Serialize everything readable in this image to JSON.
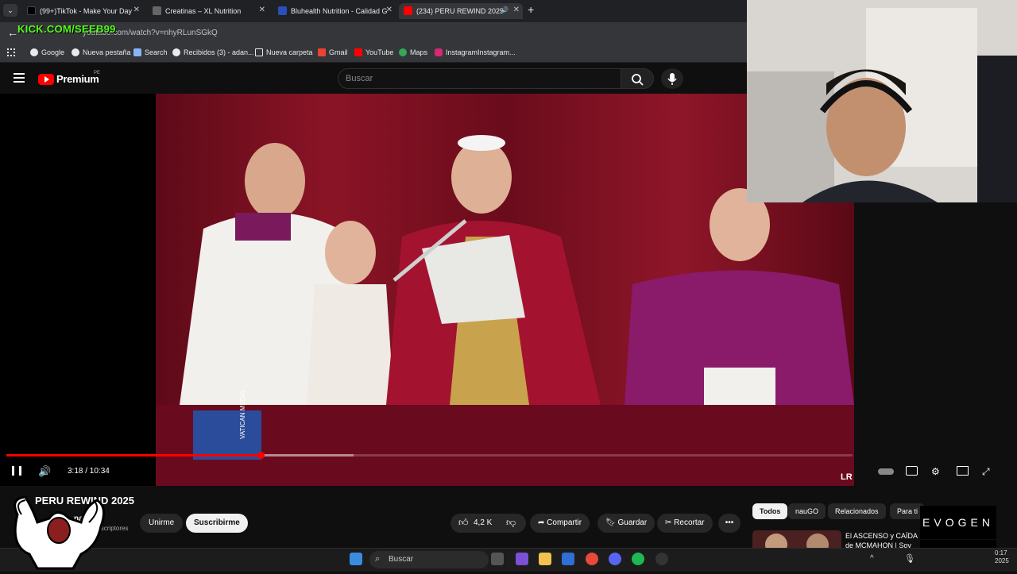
{
  "browser": {
    "tabs": [
      {
        "title": "(99+)TikTok - Make Your Day",
        "active": false
      },
      {
        "title": "Creatinas – XL Nutrition",
        "active": false
      },
      {
        "title": "Bluhealth Nutrition - Calidad G",
        "active": false
      },
      {
        "title": "(234) PERU REWIND 2025",
        "active": true
      }
    ],
    "tab_close": "✕",
    "new_tab": "+",
    "url": "youtube.com/watch?v=nhyRLunSGkQ",
    "bookmarks": [
      "Google",
      "Nueva pestaña",
      "Search",
      "Recibidos (3) - adan...",
      "Nueva carpeta",
      "Gmail",
      "YouTube",
      "Maps",
      "InstagramInstagram..."
    ]
  },
  "stream_overlay": {
    "kick_handle": "KICK.COM/SEEB99",
    "evogen_top": "EVOGEN",
    "evogen_bottom": "EVOGEN"
  },
  "youtube": {
    "brand": "Premium",
    "region": "PE",
    "search_placeholder": "Buscar",
    "player": {
      "time": "3:18 / 10:34",
      "played_fraction": 0.3,
      "loaded_fraction": 0.41,
      "watermark": "LR",
      "logo_text": "VATICAN MEDIA"
    },
    "video": {
      "title": "PERU REWIND 2025",
      "channel": "nauGO",
      "subscribers": "19,9 K suscriptores",
      "join_label": "Unirme",
      "subscribe_label": "Suscribirme",
      "likes": "4,2 K",
      "share_label": "Compartir",
      "save_label": "Guardar",
      "clip_label": "Recortar",
      "more_label": "•••"
    },
    "sidebar": {
      "chips": [
        "Todos",
        "nauGO",
        "Relacionados",
        "Para ti"
      ],
      "recommended_title": "El ASCENSO y CAÍDA de MCMAHON | Soy Edua..."
    }
  },
  "taskbar": {
    "search_placeholder": "Buscar",
    "clock_time": "0:17",
    "clock_date": "2025"
  },
  "colors": {
    "youtube_red": "#ff0000",
    "kick_green": "#53fc18",
    "curtain": "#7a0f22",
    "cardinal_purple": "#8a1a6a"
  }
}
